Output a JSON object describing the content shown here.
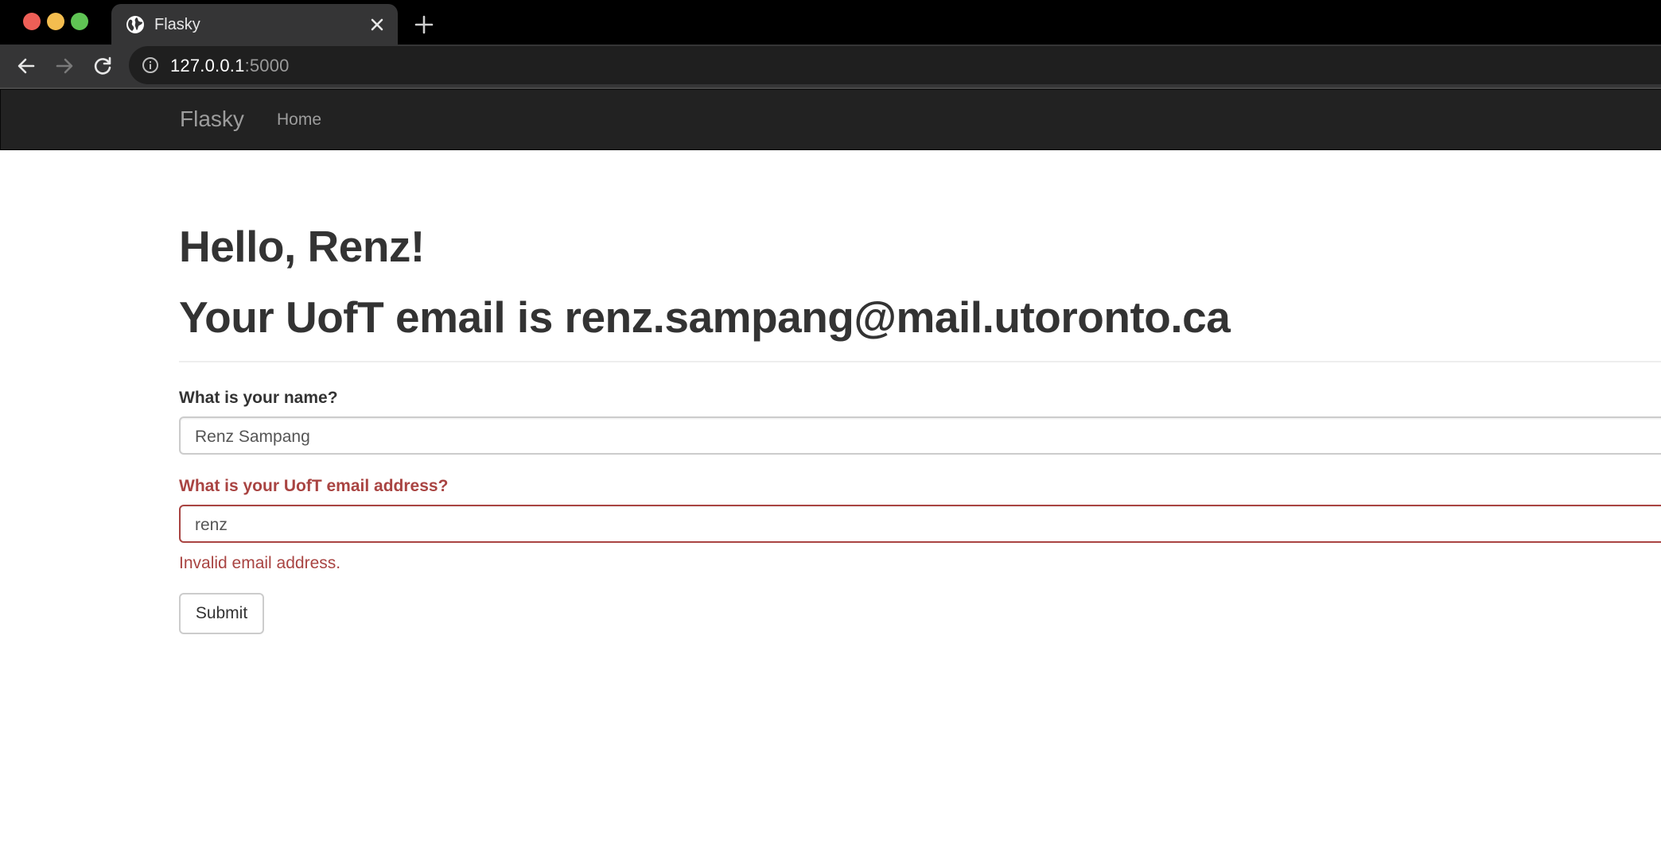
{
  "browser": {
    "tab": {
      "title": "Flasky"
    },
    "address": {
      "host": "127.0.0.1",
      "port": ":5000"
    },
    "icons": {
      "favicon": "globe-icon",
      "tab_close": "close-icon",
      "new_tab": "plus-icon",
      "back": "back-arrow-icon",
      "forward": "forward-arrow-icon",
      "reload": "reload-icon",
      "site_info": "info-icon"
    }
  },
  "navbar": {
    "brand": "Flasky",
    "links": [
      {
        "label": "Home"
      }
    ]
  },
  "main": {
    "greeting": "Hello, Renz!",
    "email_line": "Your UofT email is renz.sampang@mail.utoronto.ca",
    "form": {
      "name_label": "What is your name?",
      "name_value": "Renz Sampang",
      "email_label": "What is your UofT email address?",
      "email_value": "renz",
      "email_error": "Invalid email address.",
      "submit_label": "Submit"
    }
  },
  "colors": {
    "navbar_bg": "#222222",
    "navbar_text": "#9d9d9d",
    "heading_text": "#333333",
    "error_red": "#a94442",
    "browser_chrome": "#353536"
  }
}
